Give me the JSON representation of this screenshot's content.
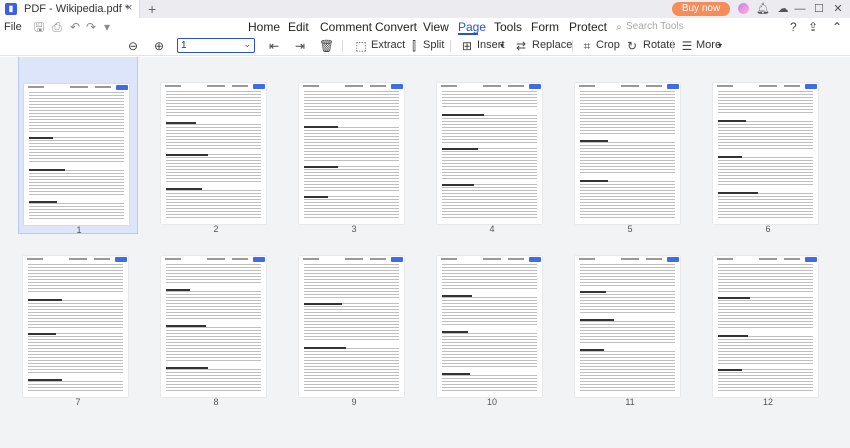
{
  "titlebar": {
    "tab_title": "PDF - Wikipedia.pdf *",
    "tab_close": "×",
    "new_tab": "+",
    "buy_label": "Buy now"
  },
  "menubar": {
    "file": "File",
    "items": [
      "Home",
      "Edit",
      "Comment",
      "Convert",
      "View",
      "Page",
      "Tools",
      "Form",
      "Protect"
    ],
    "active": "Page",
    "search_placeholder": "Search Tools"
  },
  "toolbar": {
    "page_select_value": "1",
    "extract_label": "Extract",
    "split_label": "Split",
    "insert_label": "Insert",
    "replace_label": "Replace",
    "crop_label": "Crop",
    "rotate_label": "Rotate",
    "more_label": "More"
  },
  "icons": {
    "app": "app-logo-icon",
    "zoom_out": "zoom-out-icon",
    "zoom_in": "zoom-in-icon",
    "extract": "extract-icon",
    "split": "split-icon",
    "insert": "insert-icon",
    "replace": "replace-icon",
    "crop": "crop-icon",
    "rotate": "rotate-icon",
    "more": "more-icon"
  },
  "colors": {
    "accent": "#2b50d8",
    "buy": "#f58c5a",
    "selected_bg": "#dde5fb"
  },
  "pages": [
    "1",
    "2",
    "3",
    "4",
    "5",
    "6",
    "7",
    "8",
    "9",
    "10",
    "11",
    "12"
  ],
  "selected_page": "1"
}
